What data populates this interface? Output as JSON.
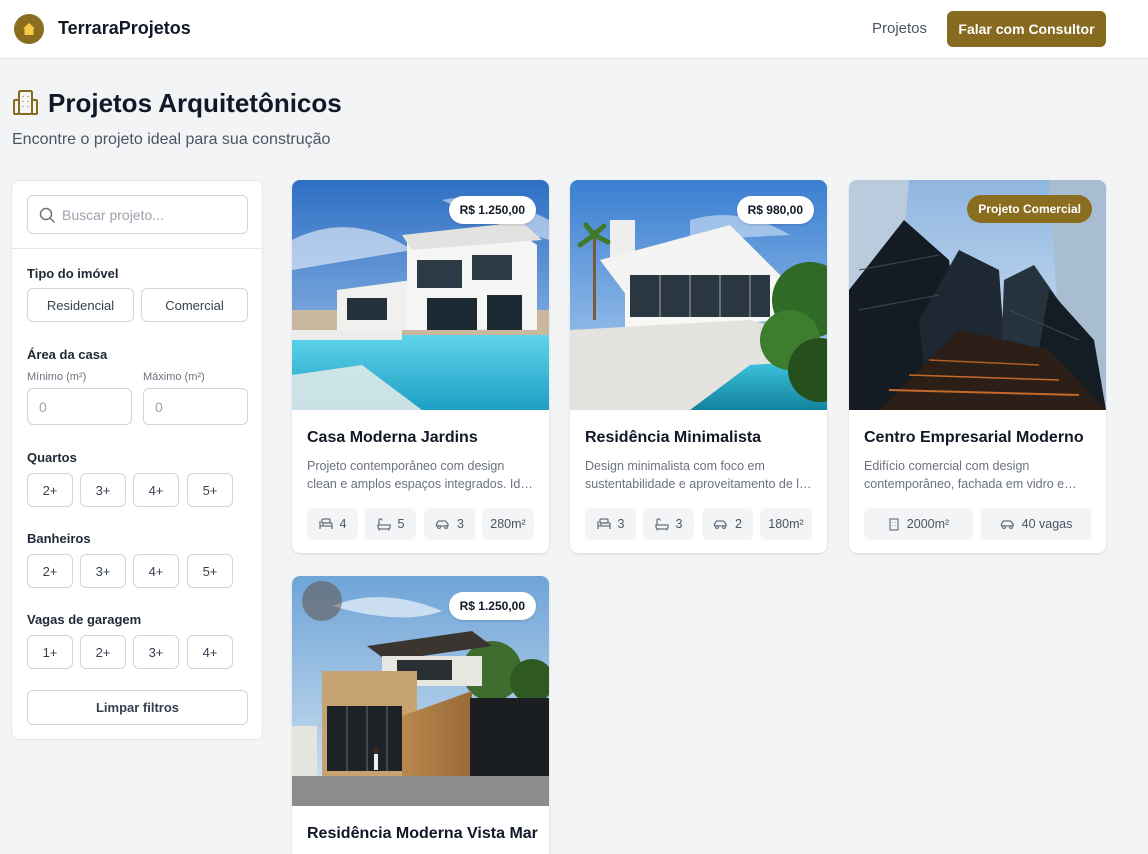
{
  "header": {
    "brand": "TerraraProjetos",
    "nav_projects": "Projetos",
    "cta": "Falar com Consultor",
    "accent_color": "#856a1f"
  },
  "page": {
    "title": "Projetos Arquitetônicos",
    "subtitle": "Encontre o projeto ideal para sua construção"
  },
  "filters": {
    "search_placeholder": "Buscar projeto...",
    "type": {
      "label": "Tipo do imóvel",
      "options": [
        "Residencial",
        "Comercial"
      ]
    },
    "area": {
      "label": "Área da casa",
      "min_label": "Mínimo (m²)",
      "max_label": "Máximo (m²)",
      "min_placeholder": "0",
      "max_placeholder": "0"
    },
    "bedrooms": {
      "label": "Quartos",
      "options": [
        "2+",
        "3+",
        "4+",
        "5+"
      ]
    },
    "bathrooms": {
      "label": "Banheiros",
      "options": [
        "2+",
        "3+",
        "4+",
        "5+"
      ]
    },
    "garage": {
      "label": "Vagas de garagem",
      "options": [
        "1+",
        "2+",
        "3+",
        "4+"
      ]
    },
    "clear": "Limpar filtros"
  },
  "projects": [
    {
      "title": "Casa Moderna Jardins",
      "price": "R$ 1.250,00",
      "description": "Projeto contemporâneo com design clean e amplos espaços integrados. Ideal para famílias.",
      "beds": "4",
      "baths": "5",
      "cars": "3",
      "area": "280m²",
      "image": "modern-house-pool"
    },
    {
      "title": "Residência Minimalista",
      "price": "R$ 980,00",
      "description": "Design minimalista com foco em sustentabilidade e aproveitamento de luz natural.",
      "beds": "3",
      "baths": "3",
      "cars": "2",
      "area": "180m²",
      "image": "minimalist-house-pool"
    },
    {
      "title": "Centro Empresarial Moderno",
      "badge": "Projeto Comercial",
      "description": "Edifício comercial com design contemporâneo, fachada em vidro e estrutura moderna.",
      "area": "2000m²",
      "parking": "40 vagas",
      "image": "glass-skyscrapers"
    },
    {
      "title": "Residência Moderna Vista Mar",
      "price": "R$ 1.250,00",
      "image": "wood-facade-house"
    }
  ]
}
